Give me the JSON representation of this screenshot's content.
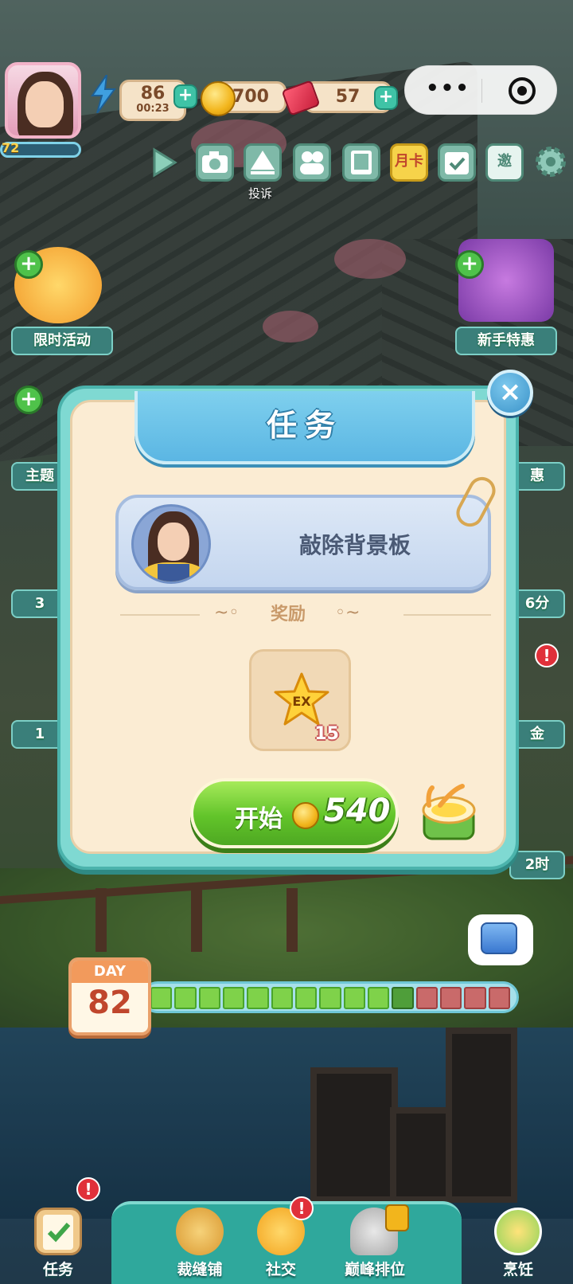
{
  "hud": {
    "energy": "86",
    "energy_timer": "00:23",
    "coins": "700",
    "gems": "57",
    "level": "72",
    "plus": "+"
  },
  "toolbar": {
    "complain_label": "投诉",
    "monthly_card_label": "月卡",
    "invite_label": "邀"
  },
  "side": {
    "limited_event": "限时活动",
    "newbie_offer": "新手特惠",
    "theme_partial": "主题",
    "offer_partial": "惠",
    "timer_partial_1": "3",
    "minutes_partial": "6分",
    "timer_partial_2": "1",
    "gold_partial": "金",
    "hours_partial": "2时"
  },
  "modal": {
    "title": "任务",
    "task_name": "敲除背景板",
    "reward_label": "奖励",
    "reward_icon_text": "EX",
    "reward_qty": "15",
    "start_label": "开始",
    "start_cost": "540",
    "close_symbol": "×"
  },
  "day": {
    "label": "DAY",
    "number": "82",
    "progress_total": 15,
    "progress_done": 11,
    "progress_current_index": 10
  },
  "nav": {
    "tasks": "任务",
    "tailor": "裁缝铺",
    "social": "社交",
    "ranking": "巅峰排位",
    "cooking": "烹饪",
    "alert": "!"
  }
}
